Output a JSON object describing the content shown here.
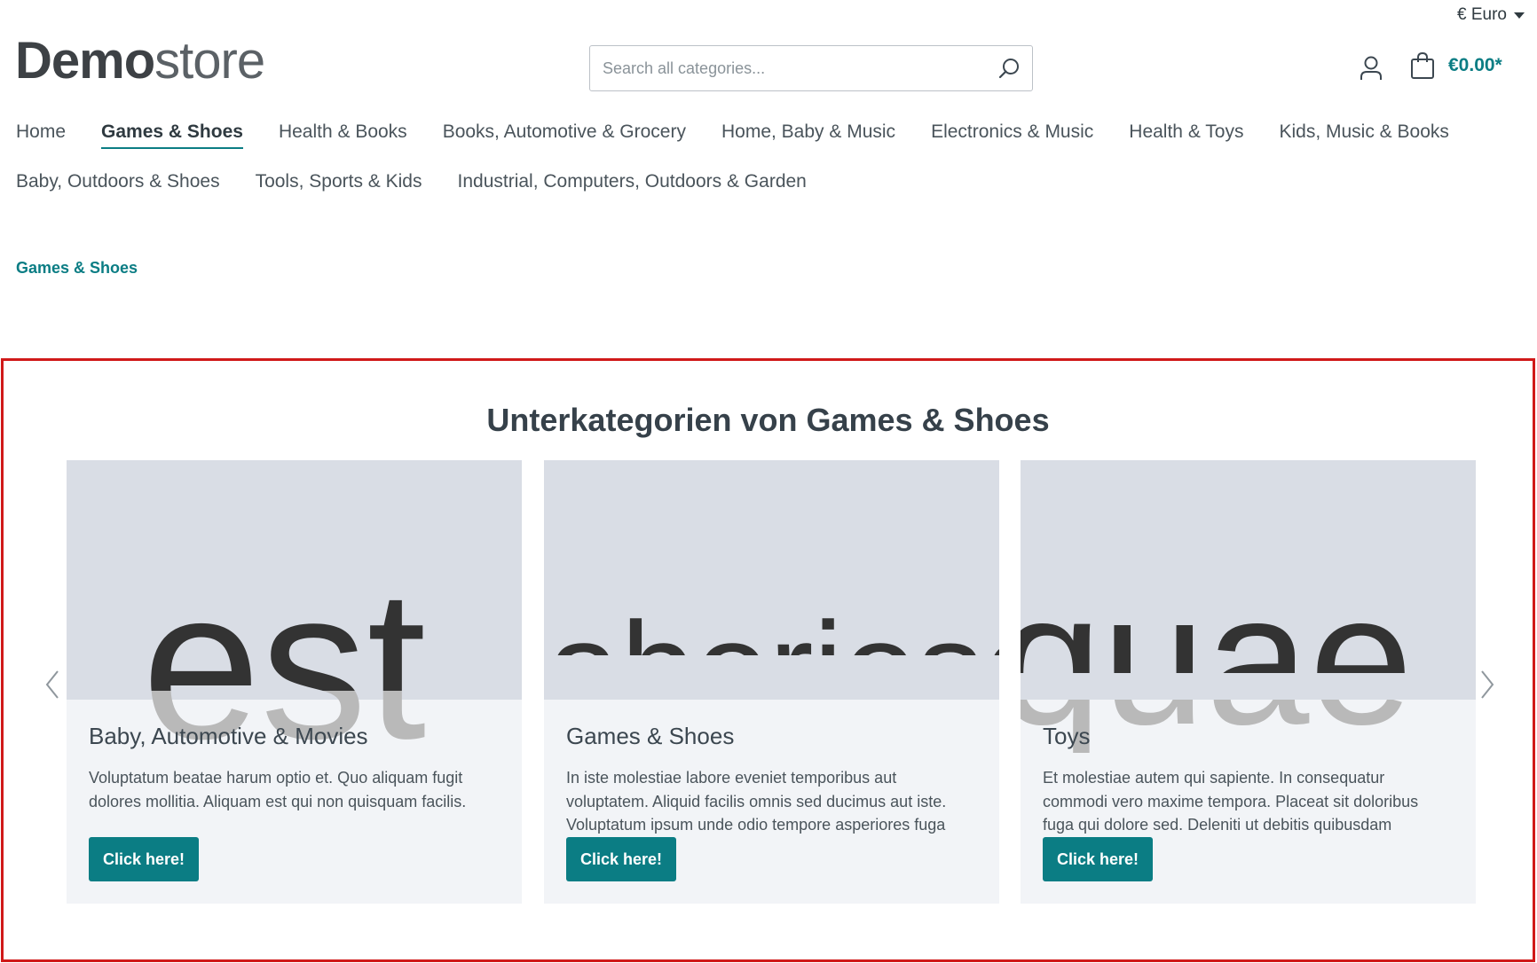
{
  "currency": {
    "label": "€ Euro"
  },
  "logo": {
    "bold": "Demo",
    "light": "store"
  },
  "search": {
    "placeholder": "Search all categories..."
  },
  "cart": {
    "total": "€0.00*"
  },
  "nav": {
    "items": [
      {
        "label": "Home"
      },
      {
        "label": "Games & Shoes"
      },
      {
        "label": "Health & Books"
      },
      {
        "label": "Books, Automotive & Grocery"
      },
      {
        "label": "Home, Baby & Music"
      },
      {
        "label": "Electronics & Music"
      },
      {
        "label": "Health & Toys"
      },
      {
        "label": "Kids, Music & Books"
      },
      {
        "label": "Baby, Outdoors & Shoes"
      },
      {
        "label": "Tools, Sports & Kids"
      },
      {
        "label": "Industrial, Computers, Outdoors & Garden"
      }
    ],
    "active": "Games & Shoes"
  },
  "breadcrumb": {
    "label": "Games & Shoes"
  },
  "subcategories": {
    "title": "Unterkategorien von Games & Shoes",
    "cards": [
      {
        "image_word": "est",
        "name": "Baby, Automotive & Movies",
        "description": "Voluptatum beatae harum optio et. Quo aliquam fugit dolores mollitia. Aliquam est qui non quisquam facilis.",
        "button": "Click here!"
      },
      {
        "image_word": "laboriosam",
        "name": "Games & Shoes",
        "description": "In iste molestiae labore eveniet temporibus aut voluptatem. Aliquid facilis omnis sed ducimus aut iste. Voluptatum ipsum unde odio tempore asperiores fuga",
        "button": "Click here!"
      },
      {
        "image_word": "quae",
        "name": "Toys",
        "description": "Et molestiae autem qui sapiente. In consequatur commodi vero maxime tempora. Placeat sit doloribus fuga qui dolore sed. Deleniti ut debitis quibusdam",
        "button": "Click here!"
      }
    ]
  },
  "colors": {
    "accent": "#0b7d84",
    "highlight_border": "#d01919",
    "card_bg": "#f2f4f7",
    "media_bg": "#d9dde5"
  }
}
